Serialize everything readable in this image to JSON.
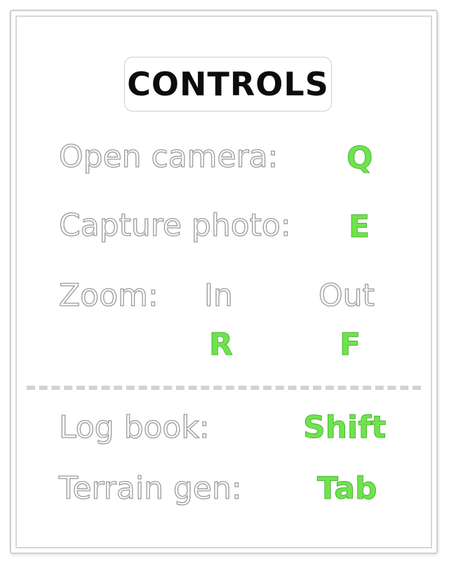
{
  "title": "CONTROLS",
  "controls": {
    "open_camera": {
      "label": "Open camera:",
      "key": "Q"
    },
    "capture_photo": {
      "label": "Capture photo:",
      "key": "E"
    },
    "zoom": {
      "label": "Zoom:",
      "in_label": "In",
      "out_label": "Out",
      "in_key": "R",
      "out_key": "F"
    },
    "log_book": {
      "label": "Log book:",
      "key": "Shift"
    },
    "terrain_gen": {
      "label": "Terrain gen:",
      "key": "Tab"
    }
  },
  "colors": {
    "key_green": "#6fe34c",
    "title_text": "#0c0c0c",
    "outline_gray": "#9a9a9a"
  }
}
